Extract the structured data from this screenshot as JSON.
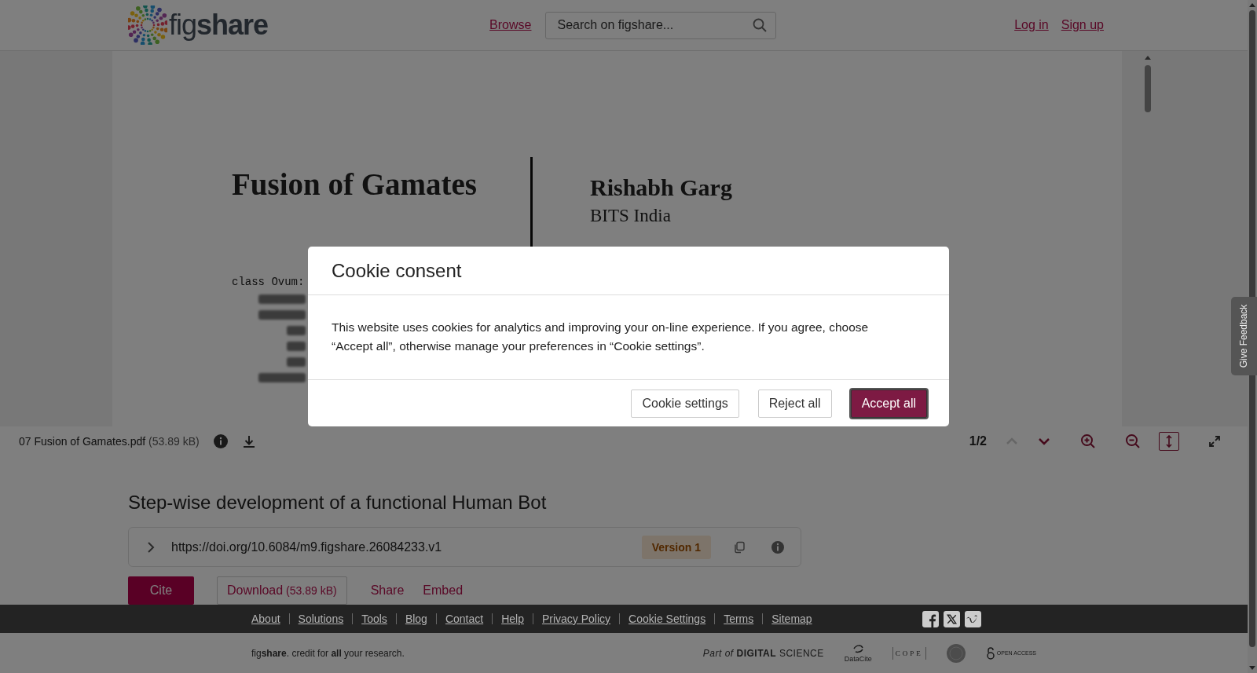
{
  "header": {
    "logo": "fig**share**",
    "nav_link": "Browse",
    "search": {
      "placeholder": "Search on figshare..."
    },
    "auth_links": [
      "Log in",
      "Sign up"
    ]
  },
  "document": {
    "title": "Fusion of Gamates",
    "author": "Rishabh Garg",
    "affiliation": "BITS India",
    "code_line": "class Ovum:"
  },
  "viewer_toolbar": {
    "file_name": "07 Fusion of Gamates.pdf",
    "file_size": "(53.89 kB)",
    "page": "1/2",
    "previous_disabled": true,
    "next_disabled": false,
    "fit_height_selected": true
  },
  "item": {
    "title": "Step-wise development of a functional Human Bot",
    "doi": "https://doi.org/10.6084/m9.figshare.26084233.v1",
    "version": "Version 1",
    "actions": [
      {
        "kind": "primary",
        "label": "Cite"
      },
      {
        "kind": "outline",
        "label": "Download",
        "detail": "(53.89 kB)"
      },
      {
        "kind": "link",
        "label": "Share"
      },
      {
        "kind": "link",
        "label": "Embed"
      }
    ]
  },
  "footer": {
    "links": [
      "About",
      "Solutions",
      "Tools",
      "Blog",
      "Contact",
      "Help",
      "Privacy Policy",
      "Cookie Settings",
      "Terms",
      "Sitemap"
    ],
    "social": [
      {
        "kind": "facebook"
      },
      {
        "kind": "x"
      },
      {
        "kind": "vimeo"
      }
    ],
    "tagline": "fig**share**. credit for **all** your research.",
    "partners": [
      {
        "kind": "digital-science",
        "text": "*Part of* **DIGITAL** SCIENCE"
      },
      {
        "kind": "datacite",
        "text": "DataCite"
      },
      {
        "kind": "cope",
        "text": "COPE"
      },
      {
        "kind": "seal"
      },
      {
        "kind": "open-access",
        "text": "OPEN ACCESS"
      }
    ]
  },
  "feedback_tab": "Give Feedback",
  "cookie_dialog": {
    "title": "Cookie consent",
    "text": "This website uses cookies for analytics and improving your on-line experience. If you agree, choose “Accept all”, otherwise manage your preferences in “Cookie settings”.",
    "buttons": [
      {
        "kind": "outline",
        "label": "Cookie settings"
      },
      {
        "kind": "outline",
        "label": "Reject all"
      },
      {
        "kind": "primary",
        "label": "Accept all"
      }
    ]
  }
}
